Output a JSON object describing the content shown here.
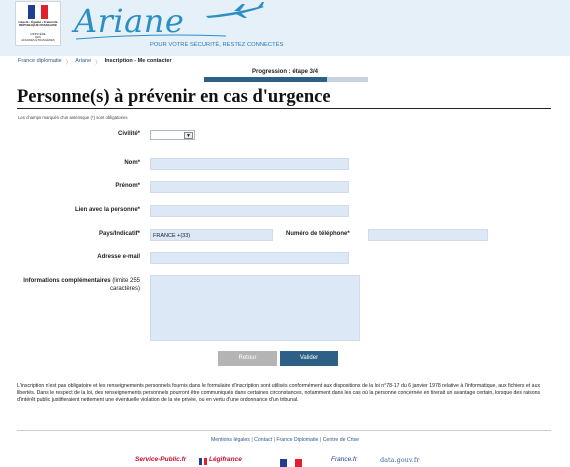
{
  "header": {
    "republic_lines": [
      "Liberté • Égalité • Fraternité",
      "RÉPUBLIQUE FRANÇAISE"
    ],
    "ministry_lines": [
      "MINISTÈRE",
      "DES",
      "AFFAIRES ÉTRANGÈRES"
    ],
    "brand": "Ariane",
    "tagline": "POUR VOTRE SÉCURITÉ, RESTEZ CONNECTÉS"
  },
  "breadcrumb": [
    "France diplomatie",
    "Ariane",
    "Inscription - Me contacter"
  ],
  "progress": {
    "label": "Progression : étape 3/4",
    "fraction": 0.75
  },
  "page_title": "Personne(s) à prévenir en cas d'urgence",
  "required_note": "Les champs marqués d'un astérisque (*) sont obligatoires",
  "form": {
    "civilite_label": "Civilité*",
    "civilite_value": "",
    "nom_label": "Nom*",
    "nom_value": "",
    "prenom_label": "Prénom*",
    "prenom_value": "",
    "lien_label": "Lien avec la personne*",
    "lien_value": "",
    "pays_label": "Pays/Indicatif*",
    "pays_value": "FRANCE +(33)",
    "telephone_label": "Numéro de téléphone*",
    "telephone_value": "",
    "email_label": "Adresse e-mail",
    "email_value": "",
    "infos_label": "Informations complémentaires",
    "infos_hint": "(limite 255 caractères)",
    "infos_value": ""
  },
  "buttons": {
    "retour": "Retour",
    "valider": "Valider"
  },
  "legal_text": "L'inscription n'est pas obligatoire et les renseignements personnels fournis dans le formulaire d'inscription sont utilisés conformément aux dispositions de la loi n°78-17 du 6 janvier 1978 relative à l'informatique, aux fichiers et aux libertés. Dans le respect de la loi, des renseignements personnels pourront être communiqués dans certaines circonstances, notamment dans les cas où la personne concernée en tirerait un avantage certain, lorsque des raisons d'intérêt public justifieraient nettement une éventuelle violation de la vie privée, ou en vertu d'une ordonnance d'un tribunal.",
  "footer_links": [
    "Mentions légales",
    "Contact",
    "France Diplomatie",
    "Centre de Crise"
  ],
  "partner_logos": [
    "Service-Public.fr",
    "Légifrance",
    "France.fr",
    "data.gouv.fr"
  ],
  "colors": {
    "accent": "#2e5f86",
    "brand": "#2a8fc4",
    "input_bg": "#dce8f6",
    "header_bg": "#e6f0f8",
    "link": "#2a5b8c"
  }
}
